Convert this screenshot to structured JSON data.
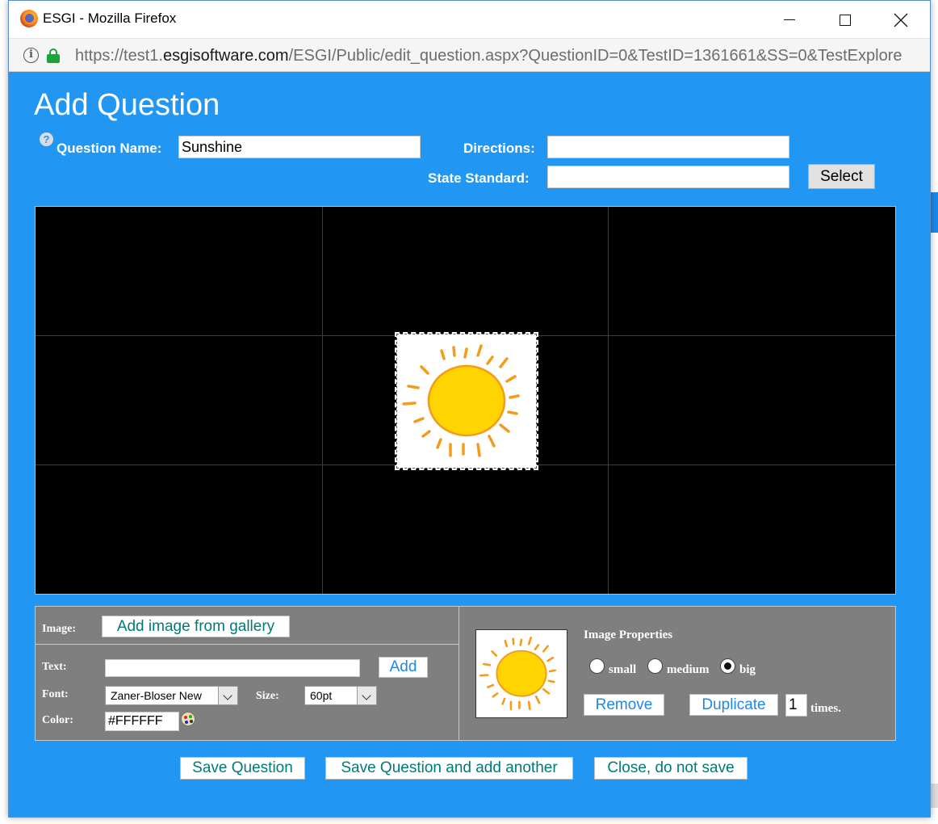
{
  "browser": {
    "window_title": "ESGI - Mozilla Firefox",
    "url_prefix": "https://test1.",
    "url_host": "esgisoftware.com",
    "url_rest": "/ESGI/Public/edit_question.aspx?QuestionID=0&TestID=1361661&SS=0&TestExplore"
  },
  "dialog": {
    "title": "Add Question",
    "question_name_label": "Question Name:",
    "question_name_value": "Sunshine",
    "directions_label": "Directions:",
    "directions_value": "",
    "state_standard_label": "State Standard:",
    "state_standard_value": "",
    "select_label": "Select"
  },
  "image_panel": {
    "image_label": "Image:",
    "add_image_label": "Add image from gallery",
    "text_label": "Text:",
    "text_value": "",
    "add_label": "Add",
    "font_label": "Font:",
    "font_value": "Zaner-Bloser New",
    "size_label": "Size:",
    "size_value": "60pt",
    "color_label": "Color:",
    "color_value": "#FFFFFF"
  },
  "image_properties": {
    "title": "Image Properties",
    "size_options": [
      "small",
      "medium",
      "big"
    ],
    "selected_size": "big",
    "remove_label": "Remove",
    "duplicate_label": "Duplicate",
    "duplicate_count": "1",
    "times_label": "times."
  },
  "footer": {
    "save_label": "Save Question",
    "save_another_label": "Save Question and add another",
    "close_label": "Close, do not save"
  },
  "colors": {
    "dialog_bg": "#2196f3",
    "panel_bg": "#7f7f7f",
    "button_text_teal": "#007a75",
    "button_text_blue": "#1e88e5",
    "sun_fill": "#ffd400",
    "sun_rays": "#f39b1b"
  }
}
